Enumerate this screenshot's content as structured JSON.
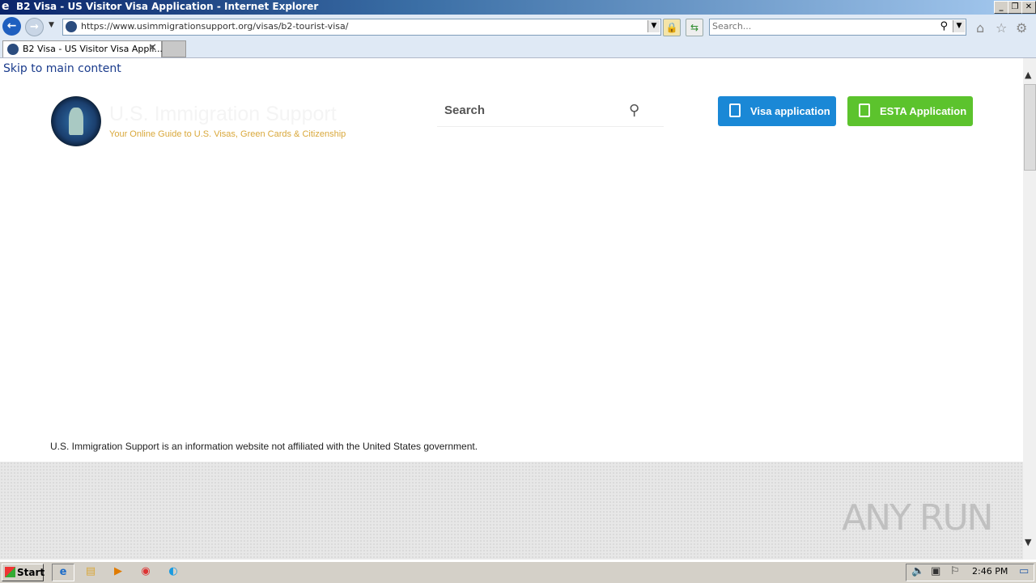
{
  "window": {
    "title": "B2 Visa - US Visitor Visa Application - Internet Explorer",
    "controls": [
      "_",
      "❐",
      "✕"
    ]
  },
  "navbar": {
    "url": "https://www.usimmigrationsupport.org/visas/b2-tourist-visa/",
    "search_placeholder": "Search..."
  },
  "tabs": [
    {
      "label": "B2 Visa - US Visitor Visa Appli...",
      "active": true
    }
  ],
  "page": {
    "skip_link": "Skip to main content",
    "site_name": "U.S. Immigration Support",
    "tagline": "Your Online Guide to U.S. Visas, Green Cards & Citizenship",
    "search_placeholder": "Search",
    "buttons": {
      "visa": "Visa application",
      "esta": "ESTA Application"
    },
    "disclaimer": "U.S. Immigration Support is an information website not affiliated with the United States government.",
    "colors": {
      "visa_button": "#1a88d6",
      "esta_button": "#5cc32d",
      "tagline": "#d9a83b"
    }
  },
  "watermark": "ANY RUN",
  "taskbar": {
    "start_label": "Start",
    "clock": "2:46 PM"
  }
}
